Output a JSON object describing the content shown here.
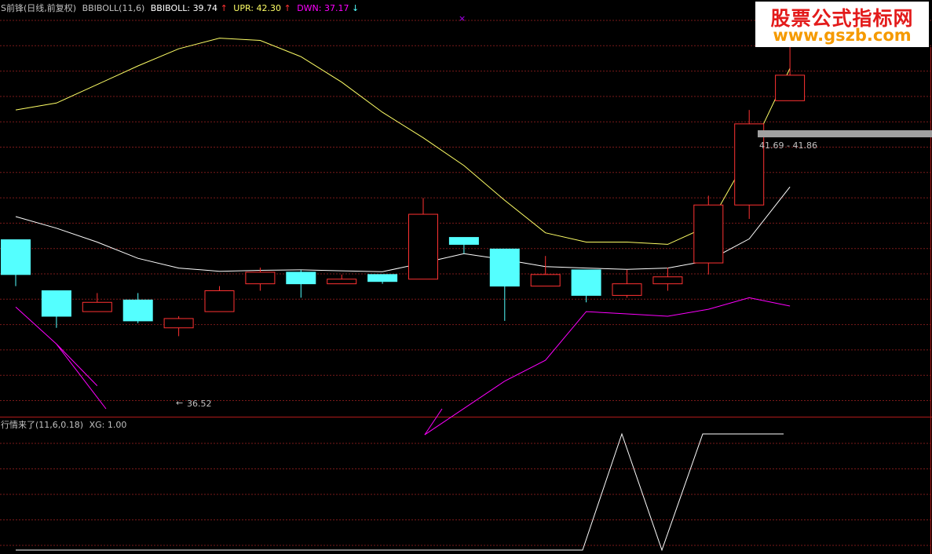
{
  "header": {
    "stock": "S前锋(日线,前复权)",
    "indicator": "BBIBOLL(11,6)",
    "bbiboll_label": "BBIBOLL:",
    "bbiboll_value": "39.74",
    "bbiboll_arrow": "↑",
    "upr_label": "UPR:",
    "upr_value": "42.30",
    "upr_arrow": "↑",
    "dwn_label": "DWN:",
    "dwn_value": "37.17",
    "dwn_arrow": "↓"
  },
  "sub_header": {
    "indicator": "行情来了(11,6,0.18)",
    "xg_label": "XG:",
    "xg_value": "1.00"
  },
  "annotations": {
    "low_marker": "36.52",
    "price_range": "41.69 - 41.86"
  },
  "marker_glyph": "×",
  "watermark": {
    "line1": "股票公式指标网",
    "line2": "www.gszb.com"
  },
  "colors": {
    "background": "#000000",
    "grid": "#7a1a1a",
    "up": "#ff3232",
    "down": "#54ffff",
    "bbiboll": "#ffffff",
    "upr": "#ffff66",
    "dwn": "#ff00ff",
    "signal": "#ffffff",
    "text": "#c0c0c0",
    "marker": "#b000ff"
  },
  "chart_data": [
    {
      "type": "candlestick",
      "title": "BBIBOLL(11,6)",
      "ylim": [
        34.8,
        43.4
      ],
      "candles": [
        {
          "o": 38.6,
          "h": 38.6,
          "l": 37.6,
          "c": 37.85
        },
        {
          "o": 37.5,
          "h": 37.5,
          "l": 36.7,
          "c": 36.95
        },
        {
          "o": 37.05,
          "h": 37.45,
          "l": 37.05,
          "c": 37.25
        },
        {
          "o": 37.3,
          "h": 37.45,
          "l": 36.8,
          "c": 36.85
        },
        {
          "o": 36.7,
          "h": 36.95,
          "l": 36.52,
          "c": 36.9
        },
        {
          "o": 37.05,
          "h": 37.6,
          "l": 37.05,
          "c": 37.5
        },
        {
          "o": 37.65,
          "h": 38.0,
          "l": 37.5,
          "c": 37.9
        },
        {
          "o": 37.9,
          "h": 37.95,
          "l": 37.35,
          "c": 37.65
        },
        {
          "o": 37.65,
          "h": 37.85,
          "l": 37.65,
          "c": 37.75
        },
        {
          "o": 37.85,
          "h": 37.85,
          "l": 37.65,
          "c": 37.7
        },
        {
          "o": 37.75,
          "h": 39.5,
          "l": 37.75,
          "c": 39.15
        },
        {
          "o": 38.65,
          "h": 38.65,
          "l": 38.3,
          "c": 38.5
        },
        {
          "o": 38.4,
          "h": 38.4,
          "l": 36.85,
          "c": 37.6
        },
        {
          "o": 37.6,
          "h": 38.25,
          "l": 37.6,
          "c": 37.85
        },
        {
          "o": 37.95,
          "h": 37.95,
          "l": 37.25,
          "c": 37.4
        },
        {
          "o": 37.4,
          "h": 37.95,
          "l": 37.35,
          "c": 37.65
        },
        {
          "o": 37.65,
          "h": 38.0,
          "l": 37.5,
          "c": 37.8
        },
        {
          "o": 38.1,
          "h": 39.55,
          "l": 37.85,
          "c": 39.35
        },
        {
          "o": 39.35,
          "h": 41.4,
          "l": 39.05,
          "c": 41.1
        },
        {
          "o": 41.6,
          "h": 43.2,
          "l": 41.6,
          "c": 42.15
        }
      ],
      "bbiboll": [
        39.4,
        39.1,
        38.85,
        38.55,
        38.2,
        37.99,
        37.92,
        37.94,
        37.95,
        37.93,
        37.91,
        38.1,
        38.3,
        38.17,
        38.02,
        37.99,
        37.96,
        37.99,
        38.15,
        38.62,
        39.74
      ],
      "upr": [
        41.65,
        41.4,
        41.55,
        41.95,
        42.35,
        42.72,
        42.95,
        42.9,
        42.55,
        42.0,
        41.35,
        40.8,
        40.2,
        39.45,
        38.75,
        38.55,
        38.55,
        38.5,
        38.9,
        40.45,
        42.3
      ],
      "dwn": [
        37.7,
        37.15,
        36.35,
        35.45,
        34.85,
        34.85,
        34.85,
        34.85,
        34.85,
        34.85,
        34.85,
        34.85,
        34.9,
        35.55,
        36.0,
        37.05,
        37.0,
        36.95,
        37.1,
        37.35,
        37.17
      ]
    },
    {
      "type": "line",
      "title": "行情来了(11,6,0.18)",
      "series": [
        {
          "name": "XG",
          "values": [
            0,
            0,
            0,
            0,
            0,
            0,
            0,
            0,
            0,
            0,
            0,
            0,
            0,
            0,
            0,
            1,
            0,
            1,
            1,
            1,
            1
          ]
        }
      ]
    }
  ]
}
